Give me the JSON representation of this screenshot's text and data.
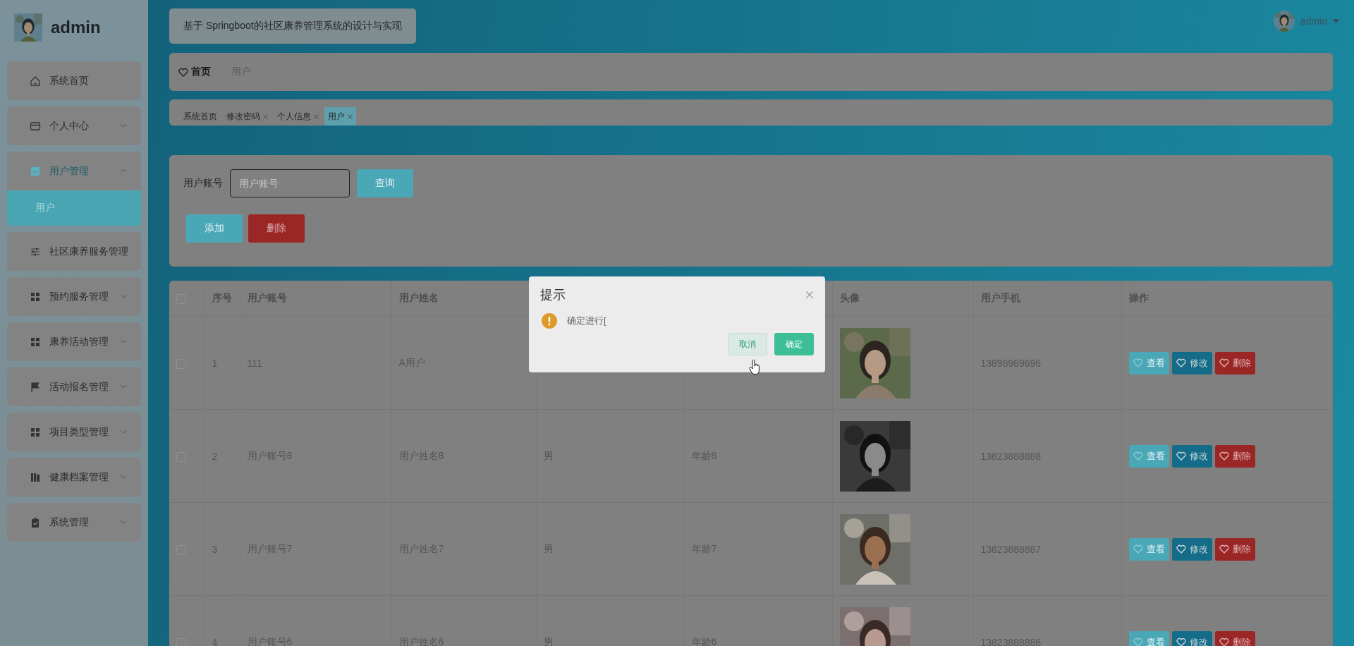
{
  "sidebar": {
    "brand": {
      "name": "admin",
      "avatar": {
        "kind": "picture"
      }
    },
    "items": [
      {
        "label": "系统首页"
      },
      {
        "label": "个人中心",
        "expanded": false
      },
      {
        "label": "用户管理",
        "expanded": true,
        "children": [
          {
            "label": "用户",
            "selected": true
          }
        ]
      },
      {
        "label": "社区康养服务管理"
      },
      {
        "label": "预约服务管理",
        "expanded": false
      },
      {
        "label": "康养活动管理",
        "expanded": false
      },
      {
        "label": "活动报名管理",
        "expanded": false
      },
      {
        "label": "项目类型管理",
        "expanded": false
      },
      {
        "label": "健康档案管理",
        "expanded": false
      },
      {
        "label": "系统管理",
        "expanded": false
      }
    ]
  },
  "header": {
    "title": "基于 Springboot的社区康养管理系统的设计与实现",
    "user": {
      "name": "admin",
      "avatar": {
        "kind": "picture"
      }
    }
  },
  "breadcrumb": [
    "首页",
    "用户"
  ],
  "tabs": [
    {
      "label": "系统首页",
      "selected": false,
      "closable": false
    },
    {
      "label": "修改密码",
      "selected": false,
      "closable": true
    },
    {
      "label": "个人信息",
      "selected": false,
      "closable": true
    },
    {
      "label": "用户",
      "selected": true,
      "closable": true
    }
  ],
  "search": {
    "label": "用户账号",
    "placeholder": "用户账号",
    "button": "查询"
  },
  "actions": [
    {
      "label": "添加",
      "kind": "add"
    },
    {
      "label": "删除",
      "kind": "delete"
    }
  ],
  "table": {
    "select_all": {
      "checked": false
    },
    "columns": [
      "序号",
      "用户账号",
      "用户姓名",
      "头像",
      "用户手机",
      "操作"
    ],
    "rows": [
      {
        "selected": false,
        "no": "1",
        "account": "111",
        "name": "A用户",
        "avatar": {
          "kind": "picture"
        },
        "phone": "13896969696",
        "actions": [
          {
            "label": "查看",
            "kind": "view"
          },
          {
            "label": "修改",
            "kind": "edit"
          },
          {
            "label": "删除",
            "kind": "delete"
          }
        ]
      },
      {
        "selected": false,
        "no": "2",
        "account": "用户账号8",
        "name": "用户姓名8",
        "gender": "男",
        "age": "年龄8",
        "avatar": {
          "kind": "picture"
        },
        "phone": "13823888888",
        "actions": [
          {
            "label": "查看",
            "kind": "view"
          },
          {
            "label": "修改",
            "kind": "edit"
          },
          {
            "label": "删除",
            "kind": "delete"
          }
        ]
      },
      {
        "selected": false,
        "no": "3",
        "account": "用户账号7",
        "name": "用户姓名7",
        "gender": "男",
        "age": "年龄7",
        "avatar": {
          "kind": "picture"
        },
        "phone": "13823888887",
        "actions": [
          {
            "label": "查看",
            "kind": "view"
          },
          {
            "label": "修改",
            "kind": "edit"
          },
          {
            "label": "删除",
            "kind": "delete"
          }
        ]
      },
      {
        "selected": false,
        "no": "4",
        "account": "用户账号6",
        "name": "用户姓名6",
        "gender": "男",
        "age": "年龄6",
        "avatar": {
          "kind": "picture"
        },
        "phone": "13823888886",
        "actions": [
          {
            "label": "查看",
            "kind": "view"
          },
          {
            "label": "修改",
            "kind": "edit"
          },
          {
            "label": "删除",
            "kind": "delete"
          }
        ]
      }
    ]
  },
  "dialog": {
    "title": "提示",
    "message": "确定进行[",
    "buttons": [
      {
        "label": "取消",
        "kind": "cancel"
      },
      {
        "label": "确定",
        "kind": "confirm"
      }
    ]
  }
}
